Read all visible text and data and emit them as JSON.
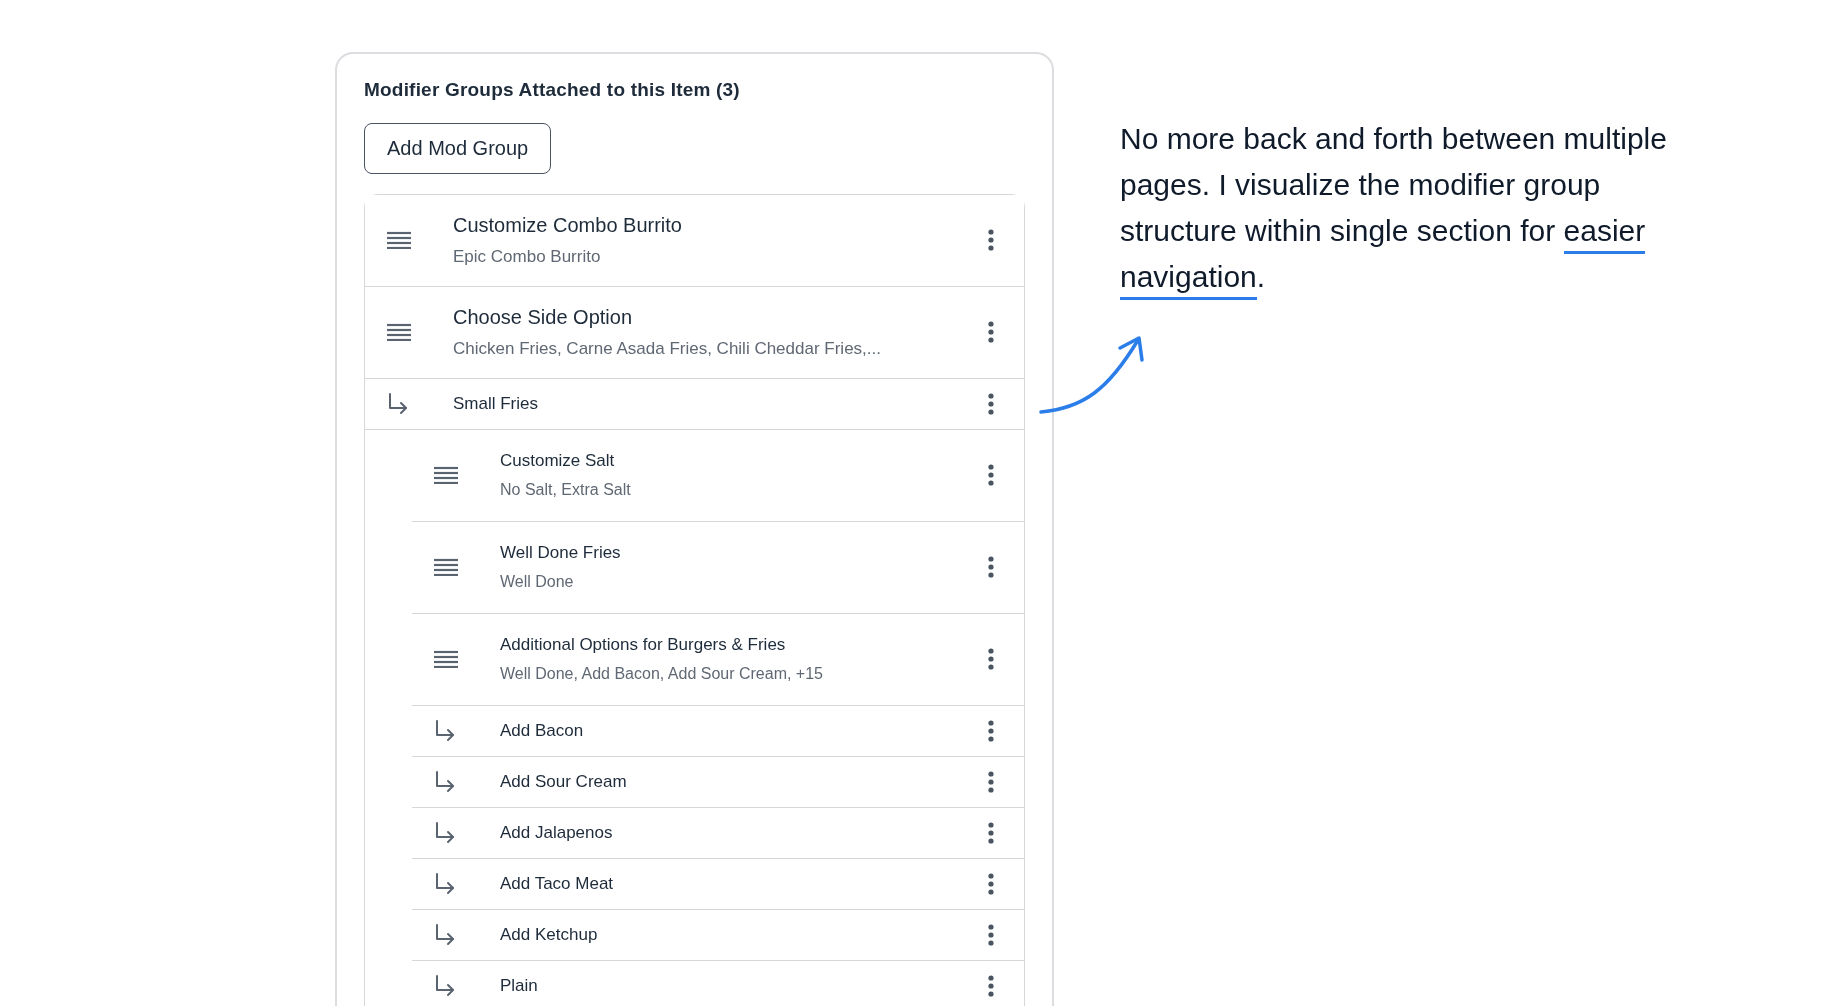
{
  "panel": {
    "title": "Modifier Groups Attached to this Item (3)",
    "add_button": "Add Mod Group",
    "items": [
      {
        "kind": "group",
        "name": "Customize Combo Burrito",
        "summary": "Epic Combo Burrito"
      },
      {
        "kind": "group",
        "name": "Choose Side Option",
        "summary": "Chicken Fries, Carne Asada Fries, Chili Cheddar Fries,...",
        "children": [
          {
            "kind": "option",
            "name": "Small Fries",
            "children": [
              {
                "kind": "group",
                "name": "Customize Salt",
                "summary": "No Salt, Extra Salt"
              },
              {
                "kind": "group",
                "name": "Well Done Fries",
                "summary": "Well Done"
              },
              {
                "kind": "group",
                "name": "Additional Options for Burgers & Fries",
                "summary": "Well Done, Add Bacon, Add Sour Cream, +15",
                "children": [
                  {
                    "kind": "option",
                    "name": "Add Bacon"
                  },
                  {
                    "kind": "option",
                    "name": "Add Sour Cream"
                  },
                  {
                    "kind": "option",
                    "name": "Add Jalapenos"
                  },
                  {
                    "kind": "option",
                    "name": "Add Taco Meat"
                  },
                  {
                    "kind": "option",
                    "name": "Add Ketchup"
                  },
                  {
                    "kind": "option",
                    "name": "Plain"
                  }
                ]
              }
            ]
          }
        ]
      }
    ]
  },
  "annotation": {
    "text_before": "No more back and forth between multiple pages. I visualize the modifier group structure within single section for ",
    "highlight": "easier navigation",
    "text_after": "."
  }
}
